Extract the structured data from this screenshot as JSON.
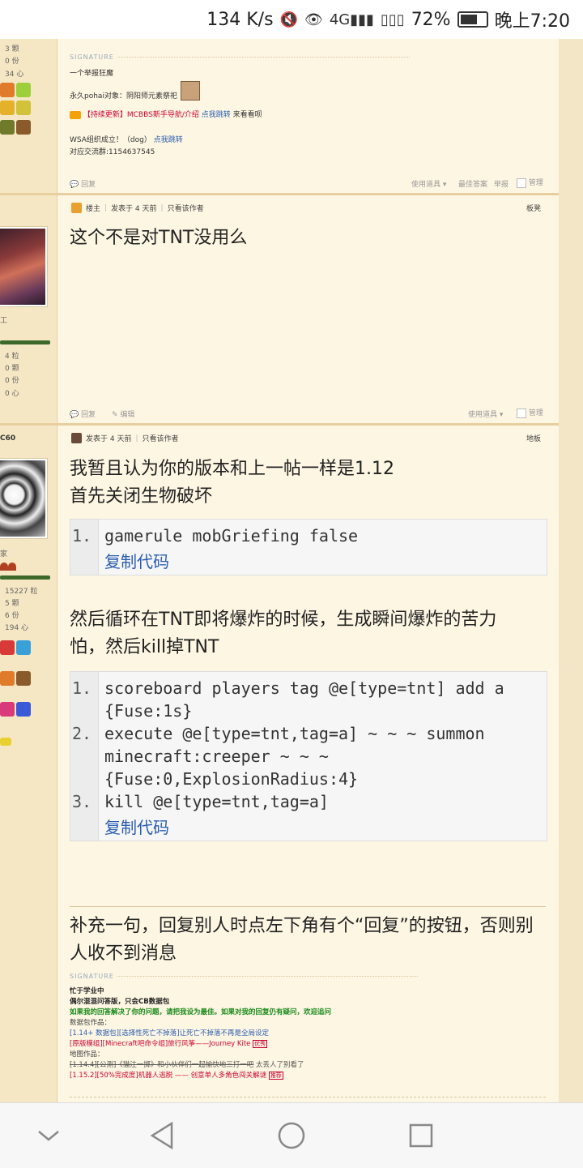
{
  "status_bar": {
    "speed": "134 K/s",
    "battery": "72%",
    "time": "晚上7:20"
  },
  "top_post": {
    "stats": [
      "3 颗",
      "0 份",
      "34 心"
    ],
    "signature_label": "SIGNATURE",
    "sig_lines": [
      "一个举报狂魔",
      "永久pohai对象：阴阳师元素祭祀"
    ],
    "sig_notice_prefix": "【持续更新】MCBBS新手导航/介绍",
    "sig_notice_link": "点我跳转",
    "sig_notice_suffix": "来看看呗",
    "sig_wsa": "WSA组织成立！（dog）",
    "sig_wsa_link": "点我跳转",
    "sig_group": "对应交流群:1154637545",
    "btn_reply": "回复",
    "btn_tools": "使用道具",
    "btn_best": "最佳答案",
    "btn_report": "举报",
    "btn_manage": "管理"
  },
  "post2": {
    "role": "楼主",
    "posted": "发表于 4 天前",
    "only_author": "只看该作者",
    "floor": "板凳",
    "body": "这个不是对TNT没用么",
    "side_text": "工",
    "stats": [
      "4 粒",
      "0 颗",
      "0 份",
      "0 心"
    ],
    "btn_reply": "回复",
    "btn_edit": "编辑",
    "btn_tools": "使用道具",
    "btn_manage": "管理"
  },
  "post3": {
    "username_fragment": "C60",
    "posted": "发表于 4 天前",
    "only_author": "只看该作者",
    "floor": "地板",
    "side_text": "家",
    "stats": [
      "15227 粒",
      "5 颗",
      "6 份",
      "194 心"
    ],
    "line1": "我暂且认为你的版本和上一帖一样是1.12",
    "line2": "首先关闭生物破坏",
    "code1": {
      "lines": [
        "gamerule mobGriefing false"
      ],
      "copy": "复制代码"
    },
    "para2": "然后循环在TNT即将爆炸的时候，生成瞬间爆炸的苦力怕，然后kill掉TNT",
    "code2": {
      "lines": [
        "scoreboard players tag @e[type=tnt] add a {Fuse:1s}",
        "execute @e[type=tnt,tag=a] ~ ~ ~ summon minecraft:creeper ~ ~ ~ {Fuse:0,ExplosionRadius:4}",
        "kill @e[type=tnt,tag=a]"
      ],
      "copy": "复制代码"
    },
    "para3": "补充一句，回复别人时点左下角有个“回复”的按钮，否则别人收不到消息",
    "signature_label": "SIGNATURE",
    "sig1": "忙于学业中",
    "sig2": "偶尔混混问答版，只会CB数据包",
    "sig3": "如果我的回答解决了你的问题，请把我设为最佳。如果对我的回复仍有疑问，欢迎追问",
    "sig4": "数据包作品：",
    "sig5": "[1.14+ 数据包][选择性死亡不掉落]让死亡不掉落不再是全局设定",
    "sig6": "[原版模组][Minecraft吧命令组]旅行风筝——Journey Kite",
    "sig6_badge": "优秀",
    "sig7": "地图作品：",
    "sig8_strike": "[1.14.4][公测]《猫注一掷》和小伙伴们一起愉快地三打一吧",
    "sig8_rest": "太丢人了别看了",
    "sig9": "[1.15.2][50%完成度]机器人逃脱 —— 创意单人多角色闯关解谜",
    "sig9_badge": "推荐"
  }
}
